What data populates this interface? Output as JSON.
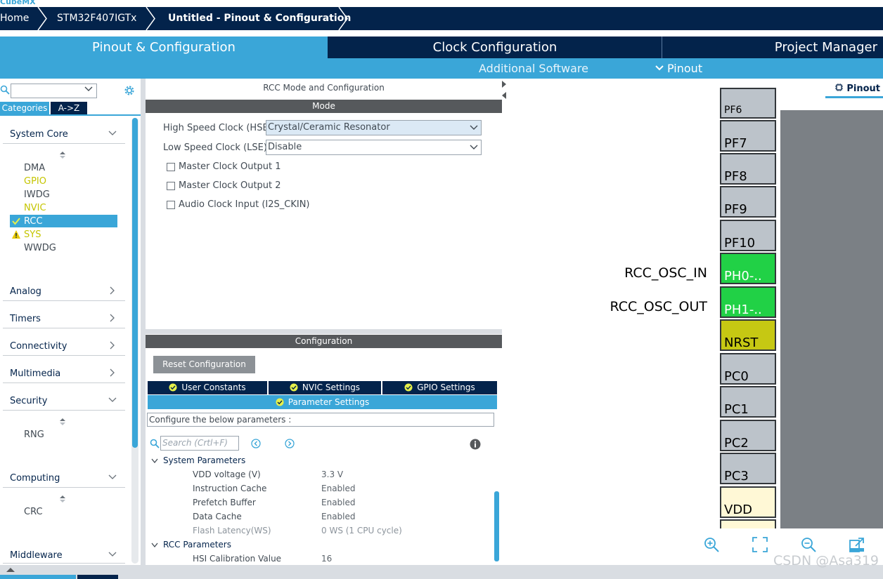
{
  "app_name": "CubeMX",
  "breadcrumb": {
    "home": "Home",
    "chip": "STM32F407IGTx",
    "project": "Untitled - Pinout & Configuration"
  },
  "main_tabs": {
    "pinout": "Pinout & Configuration",
    "clock": "Clock Configuration",
    "project": "Project Manager"
  },
  "sub_tabs": {
    "additional_software": "Additional Software",
    "pinout": "Pinout"
  },
  "left": {
    "search_value": "",
    "tab_categories": "Categories",
    "tab_az": "A->Z",
    "groups": {
      "system_core": "System Core",
      "analog": "Analog",
      "timers": "Timers",
      "connectivity": "Connectivity",
      "multimedia": "Multimedia",
      "security": "Security",
      "computing": "Computing",
      "middleware": "Middleware"
    },
    "system_core_items": [
      "DMA",
      "GPIO",
      "IWDG",
      "NVIC",
      "RCC",
      "SYS",
      "WWDG"
    ],
    "security_items": [
      "RNG"
    ],
    "computing_items": [
      "CRC"
    ]
  },
  "mode": {
    "title": "RCC Mode and Configuration",
    "header": "Mode",
    "hse_label": "High Speed Clock (HSE)",
    "hse_value": "Crystal/Ceramic Resonator",
    "lse_label": "Low Speed Clock (LSE)",
    "lse_value": "Disable",
    "mco1_label": "Master Clock Output 1",
    "mco2_label": "Master Clock Output 2",
    "audio_label": "Audio Clock Input (I2S_CKIN)"
  },
  "config": {
    "header": "Configuration",
    "reset_button": "Reset Configuration",
    "tabs": {
      "user_constants": "User Constants",
      "nvic": "NVIC Settings",
      "gpio": "GPIO Settings",
      "parameter": "Parameter Settings"
    },
    "configure_text": "Configure the below parameters :",
    "search_placeholder": "Search (Crtl+F)",
    "system_parameters": "System Parameters",
    "rcc_parameters": "RCC Parameters",
    "params": [
      {
        "name": "VDD voltage (V)",
        "value": "3.3 V"
      },
      {
        "name": "Instruction Cache",
        "value": "Enabled"
      },
      {
        "name": "Prefetch Buffer",
        "value": "Enabled"
      },
      {
        "name": "Data Cache",
        "value": "Enabled"
      },
      {
        "name": "Flash Latency(WS)",
        "value": "0 WS (1 CPU cycle)"
      }
    ],
    "rcc_params": [
      {
        "name": "HSI Calibration Value",
        "value": "16"
      }
    ]
  },
  "pinout_view": {
    "tag": "Pinout",
    "pins": [
      {
        "name": "PF6",
        "kind": "grey"
      },
      {
        "name": "PF7",
        "kind": "grey"
      },
      {
        "name": "PF8",
        "kind": "grey"
      },
      {
        "name": "PF9",
        "kind": "grey"
      },
      {
        "name": "PF10",
        "kind": "grey"
      },
      {
        "name": "PH0-..",
        "kind": "green"
      },
      {
        "name": "PH1-..",
        "kind": "green"
      },
      {
        "name": "NRST",
        "kind": "olive"
      },
      {
        "name": "PC0",
        "kind": "grey"
      },
      {
        "name": "PC1",
        "kind": "grey"
      },
      {
        "name": "PC2",
        "kind": "grey"
      },
      {
        "name": "PC3",
        "kind": "grey"
      },
      {
        "name": "VDD",
        "kind": "cream"
      }
    ],
    "labels": {
      "osc_in": "RCC_OSC_IN",
      "osc_out": "RCC_OSC_OUT"
    }
  },
  "watermark": "CSDN @Asa319",
  "colors": {
    "navy": "#03234b",
    "accent": "#3aa6d8",
    "pin_green": "#21d146",
    "pin_olive": "#c6c813",
    "pin_cream": "#fff8d6",
    "warn_yellow": "#e8c800",
    "check_green": "#c5c500"
  }
}
